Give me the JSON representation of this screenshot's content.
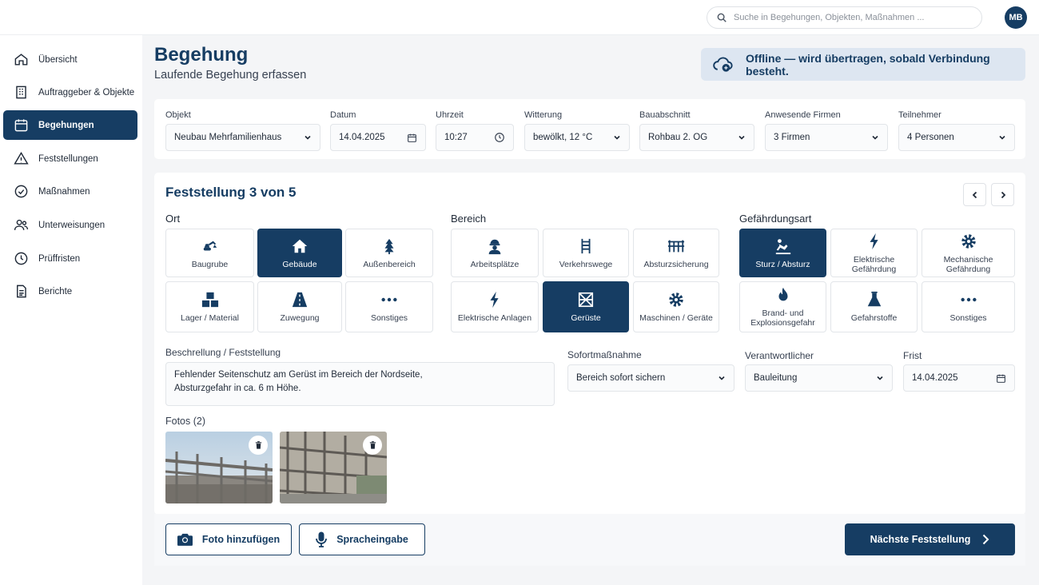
{
  "search": {
    "placeholder": "Suche in Begehungen, Objekten, Maßnahmen ..."
  },
  "user": {
    "initials": "MB"
  },
  "sidebar": {
    "items": [
      {
        "label": "Übersicht",
        "icon": "home-icon"
      },
      {
        "label": "Auftraggeber & Objekte",
        "icon": "building-icon"
      },
      {
        "label": "Begehungen",
        "icon": "calendar-icon",
        "active": true
      },
      {
        "label": "Feststellungen",
        "icon": "warning-icon"
      },
      {
        "label": "Maßnahmen",
        "icon": "check-circle-icon"
      },
      {
        "label": "Unterweisungen",
        "icon": "users-icon"
      },
      {
        "label": "Prüffristen",
        "icon": "clock-icon"
      },
      {
        "label": "Berichte",
        "icon": "document-icon"
      }
    ]
  },
  "page": {
    "title": "Begehung",
    "subtitle": "Laufende Begehung erfassen"
  },
  "offline_banner": {
    "text": "Offline — wird übertragen, sobald Verbindung besteht.",
    "icon": "cloud-sync-icon"
  },
  "header_fields": {
    "objekt": {
      "label": "Objekt",
      "value": "Neubau Mehrfamilienhaus"
    },
    "datum": {
      "label": "Datum",
      "value": "14.04.2025"
    },
    "uhrzeit": {
      "label": "Uhrzeit",
      "value": "10:27"
    },
    "witterung": {
      "label": "Witterung",
      "value": "bewölkt, 12 °C"
    },
    "bauabschnitt": {
      "label": "Bauabschnitt",
      "value": "Rohbau 2. OG"
    },
    "firmen": {
      "label": "Anwesende Firmen",
      "value": "3 Firmen"
    },
    "teilnehmer": {
      "label": "Teilnehmer",
      "value": "4 Personen"
    }
  },
  "finding": {
    "title": "Feststellung 3 von 5",
    "ort": {
      "label": "Ort",
      "options": [
        {
          "label": "Baugrube",
          "icon": "excavator-icon"
        },
        {
          "label": "Gebäude",
          "icon": "house-icon",
          "selected": true
        },
        {
          "label": "Außenbereich",
          "icon": "tree-icon"
        },
        {
          "label": "Lager / Material",
          "icon": "boxes-icon"
        },
        {
          "label": "Zuwegung",
          "icon": "road-icon"
        },
        {
          "label": "Sonstiges",
          "icon": "more-icon"
        }
      ]
    },
    "bereich": {
      "label": "Bereich",
      "options": [
        {
          "label": "Arbeitsplätze",
          "icon": "worker-icon"
        },
        {
          "label": "Verkehrswege",
          "icon": "ladder-icon"
        },
        {
          "label": "Absturzsicherung",
          "icon": "railing-icon"
        },
        {
          "label": "Elektrische Anlagen",
          "icon": "lightning-icon"
        },
        {
          "label": "Gerüste",
          "icon": "scaffold-icon",
          "selected": true
        },
        {
          "label": "Maschinen / Geräte",
          "icon": "gear-icon"
        }
      ]
    },
    "gefaehrdung": {
      "label": "Gefährdungsart",
      "options": [
        {
          "label": "Sturz / Absturz",
          "icon": "fall-icon",
          "selected": true
        },
        {
          "label": "Elektrische Gefährdung",
          "icon": "lightning-icon"
        },
        {
          "label": "Mechanische Gefährdung",
          "icon": "gear-icon"
        },
        {
          "label": "Brand- und Explosionsgefahr",
          "icon": "flame-icon"
        },
        {
          "label": "Gefahrstoffe",
          "icon": "flask-icon"
        },
        {
          "label": "Sonstiges",
          "icon": "more-icon"
        }
      ]
    },
    "beschreibung": {
      "label": "Beschrellung / Feststellung",
      "value": "Fehlender Seitenschutz am Gerüst im Bereich der Nordseite,\nAbsturzgefahr in ca. 6 m Höhe."
    },
    "sofort": {
      "label": "Sofortmaßnahme",
      "value": "Bereich sofort sichern"
    },
    "verantwortlich": {
      "label": "Verantwortlicher",
      "value": "Bauleitung"
    },
    "frist": {
      "label": "Frist",
      "value": "14.04.2025"
    },
    "fotos": {
      "label": "Fotos (2)"
    }
  },
  "actions": {
    "add_photo": "Foto hinzufügen",
    "voice": "Spracheingabe",
    "next": "Nächste Feststellung"
  },
  "colors": {
    "primary": "#163d63",
    "banner": "#dde6f1",
    "background": "#f4f5f7"
  }
}
